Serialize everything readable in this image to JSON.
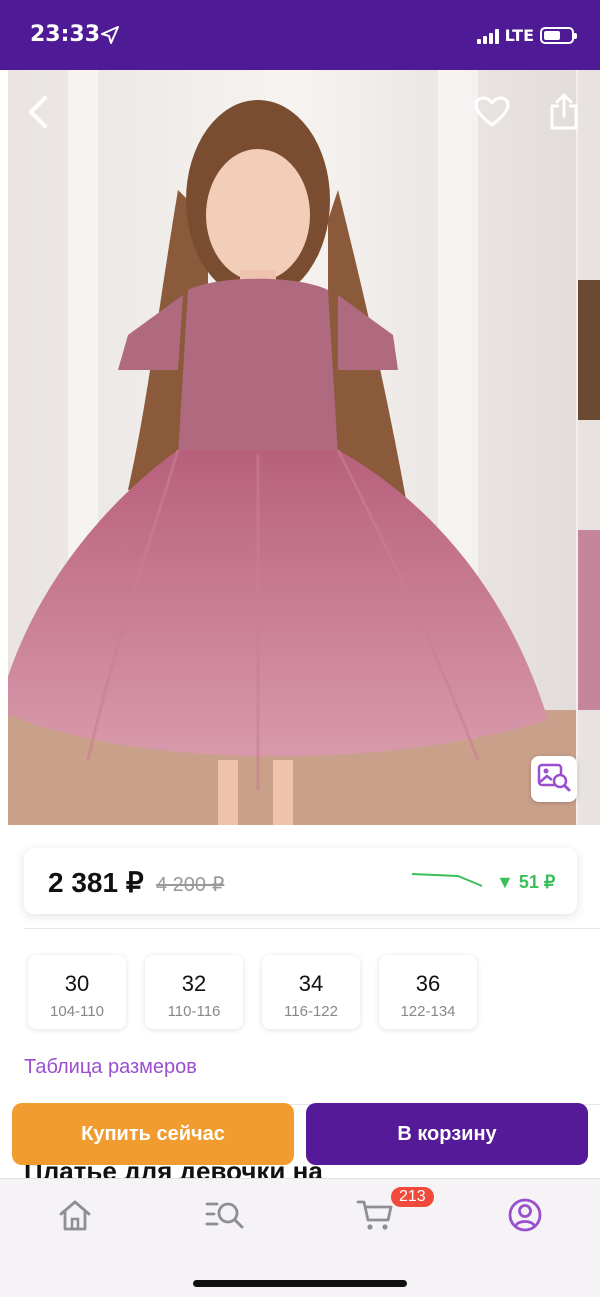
{
  "status_bar": {
    "time": "23:33",
    "network": "LTE",
    "background": "#4f1a95"
  },
  "gallery": {
    "image_subject": "girl-in-pink-tulle-dress-photo",
    "back_icon": "chevron-left-icon",
    "favorite_icon": "heart-outline-icon",
    "share_icon": "share-icon",
    "visual_search_icon": "image-search-icon"
  },
  "price": {
    "current": "2 381 ₽",
    "old": "4 200 ₽",
    "drop": "▼ 51 ₽",
    "drop_color": "#3cbf5a"
  },
  "sizes": [
    {
      "size": "30",
      "range": "104-110"
    },
    {
      "size": "32",
      "range": "110-116"
    },
    {
      "size": "34",
      "range": "116-122"
    },
    {
      "size": "36",
      "range": "122-134"
    }
  ],
  "size_table_link": "Таблица размеров",
  "product_title": "Платье для девочки на",
  "actions": {
    "buy_now": "Купить сейчас",
    "buy_now_color": "#f19c2e",
    "add_to_cart": "В корзину",
    "add_to_cart_color": "#551a97"
  },
  "tab_bar": {
    "cart_badge": "213",
    "active_color": "#9a4fcf",
    "tabs": [
      "home-icon",
      "catalog-search-icon",
      "cart-icon",
      "profile-icon"
    ]
  }
}
